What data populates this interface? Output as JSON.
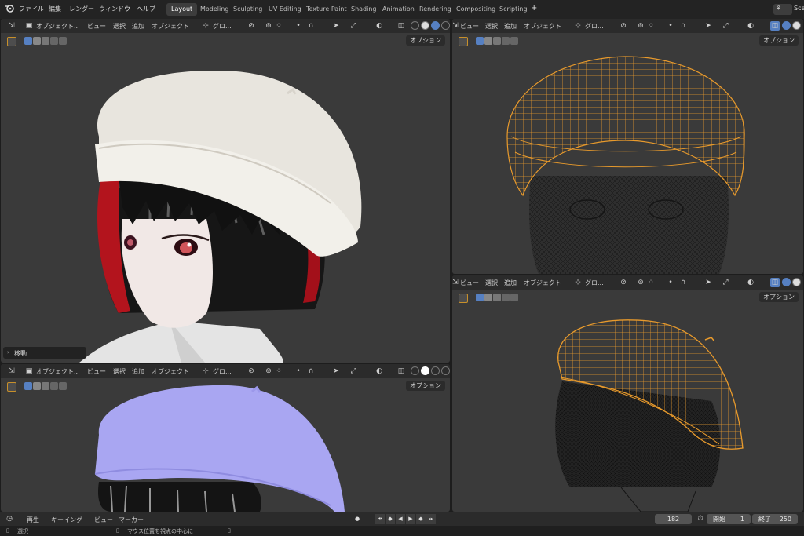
{
  "menu": {
    "logo": "blender-icon",
    "items": [
      "ファイル",
      "編集",
      "レンダー",
      "ウィンドウ",
      "ヘルプ"
    ]
  },
  "workspaces": {
    "tabs": [
      "Layout",
      "Modeling",
      "Sculpting",
      "UV Editing",
      "Texture Paint",
      "Shading",
      "Animation",
      "Rendering",
      "Compositing",
      "Scripting"
    ],
    "active": "Layout",
    "add": "+"
  },
  "scene_label": "Sce",
  "viewport_tl": {
    "mode": "オブジェクト...",
    "view": "ビュー",
    "select": "選択",
    "add": "追加",
    "object": "オブジェクト",
    "orientation": "グロ...",
    "options": "オプション",
    "operator_panel": "移動"
  },
  "viewport_tr": {
    "view": "ビュー",
    "select": "選択",
    "add": "追加",
    "object": "オブジェクト",
    "orientation": "グロ...",
    "options": "オプション"
  },
  "viewport_bl": {
    "mode": "オブジェクト...",
    "view": "ビュー",
    "select": "選択",
    "add": "追加",
    "object": "オブジェクト",
    "orientation": "グロ...",
    "options": "オプション"
  },
  "viewport_br": {
    "view": "ビュー",
    "select": "選択",
    "add": "追加",
    "object": "オブジェクト",
    "orientation": "グロ...",
    "options": "オプション"
  },
  "timeline": {
    "playback": "再生",
    "keying": "キーイング",
    "view": "ビュー",
    "marker": "マーカー",
    "current_frame": "182",
    "start_label": "開始",
    "start": "1",
    "end_label": "終了",
    "end": "250"
  },
  "status": {
    "select": "選択",
    "center_view": "マウス位置を視点の中心に"
  },
  "colors": {
    "background": "#1d1d1d",
    "viewport_bg": "#3a3a3a",
    "header": "#2b2b2b",
    "accent": "#5680c2",
    "wire_selected": "#e89a2c",
    "wire_mesh": "#111111",
    "matcap_blue": "#a9a6f2"
  }
}
